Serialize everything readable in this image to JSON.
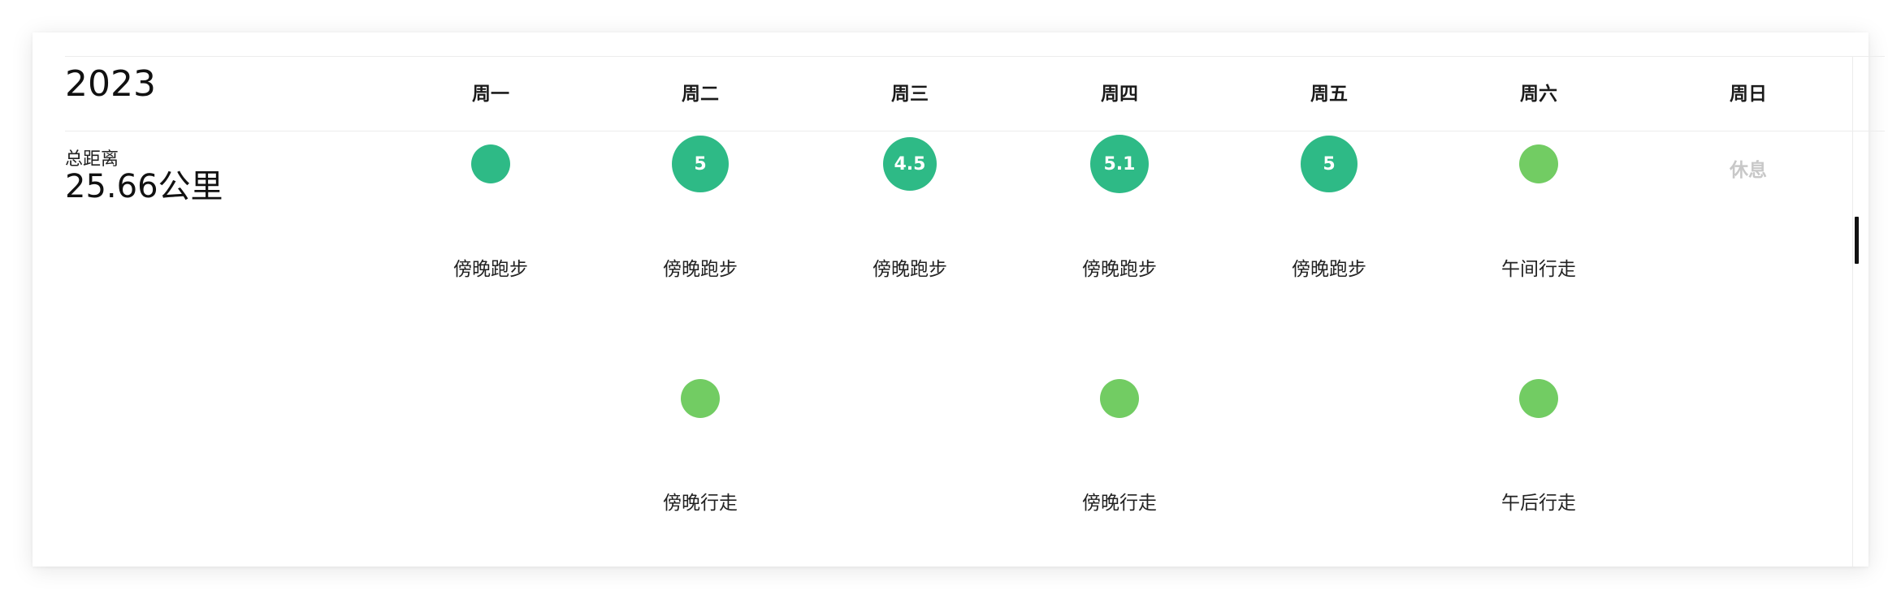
{
  "year": "2023",
  "summary": {
    "total_label": "总距离",
    "total_value": "25.66公里"
  },
  "days": [
    {
      "label": "周一"
    },
    {
      "label": "周二"
    },
    {
      "label": "周三"
    },
    {
      "label": "周四"
    },
    {
      "label": "周五"
    },
    {
      "label": "周六"
    },
    {
      "label": "周日"
    }
  ],
  "activities": {
    "mon_1": {
      "kind": "run",
      "distance": "",
      "label": "傍晚跑步"
    },
    "tue_1": {
      "kind": "run",
      "distance": "5",
      "label": "傍晚跑步"
    },
    "tue_2": {
      "kind": "walk",
      "distance": "",
      "label": "傍晚行走"
    },
    "wed_1": {
      "kind": "run",
      "distance": "4.5",
      "label": "傍晚跑步"
    },
    "thu_1": {
      "kind": "run",
      "distance": "5.1",
      "label": "傍晚跑步"
    },
    "thu_2": {
      "kind": "walk",
      "distance": "",
      "label": "傍晚行走"
    },
    "fri_1": {
      "kind": "run",
      "distance": "5",
      "label": "傍晚跑步"
    },
    "sat_1": {
      "kind": "walk",
      "distance": "",
      "label": "午间行走"
    },
    "sat_2": {
      "kind": "walk",
      "distance": "",
      "label": "午后行走"
    }
  },
  "sunday_status": "休息",
  "colors": {
    "run": "#2eba86",
    "walk": "#72cc63",
    "rest_text": "#c8c8c8"
  }
}
